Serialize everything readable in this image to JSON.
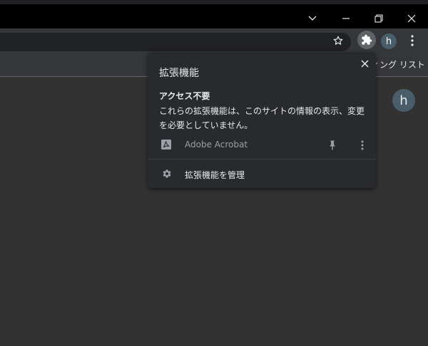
{
  "window": {
    "controls": [
      "chevron-down",
      "minimize",
      "restore",
      "close"
    ]
  },
  "toolbar": {
    "profile_initial": "h",
    "icons": [
      "star-icon",
      "puzzle-icon",
      "more-vert-icon"
    ]
  },
  "bookmarks_bar": {
    "reading_list_label": "ィング リスト"
  },
  "content": {
    "profile_initial": "h"
  },
  "extensions_popup": {
    "title": "拡張機能",
    "section_heading": "アクセス不要",
    "section_description": "これらの拡張機能は、このサイトの情報の表示、変更を必要としていません。",
    "extensions": [
      {
        "name": "Adobe Acrobat",
        "icon": "pdf-icon"
      }
    ],
    "manage_label": "拡張機能を管理"
  },
  "colors": {
    "titlebar": "#000000",
    "toolbar": "#35363a",
    "omnibox": "#202124",
    "content_bg": "#323232",
    "popup_bg": "#292a2d",
    "text_primary": "#e8eaed",
    "text_secondary": "#9aa0a6",
    "avatar_bg": "#4a5d6b"
  }
}
